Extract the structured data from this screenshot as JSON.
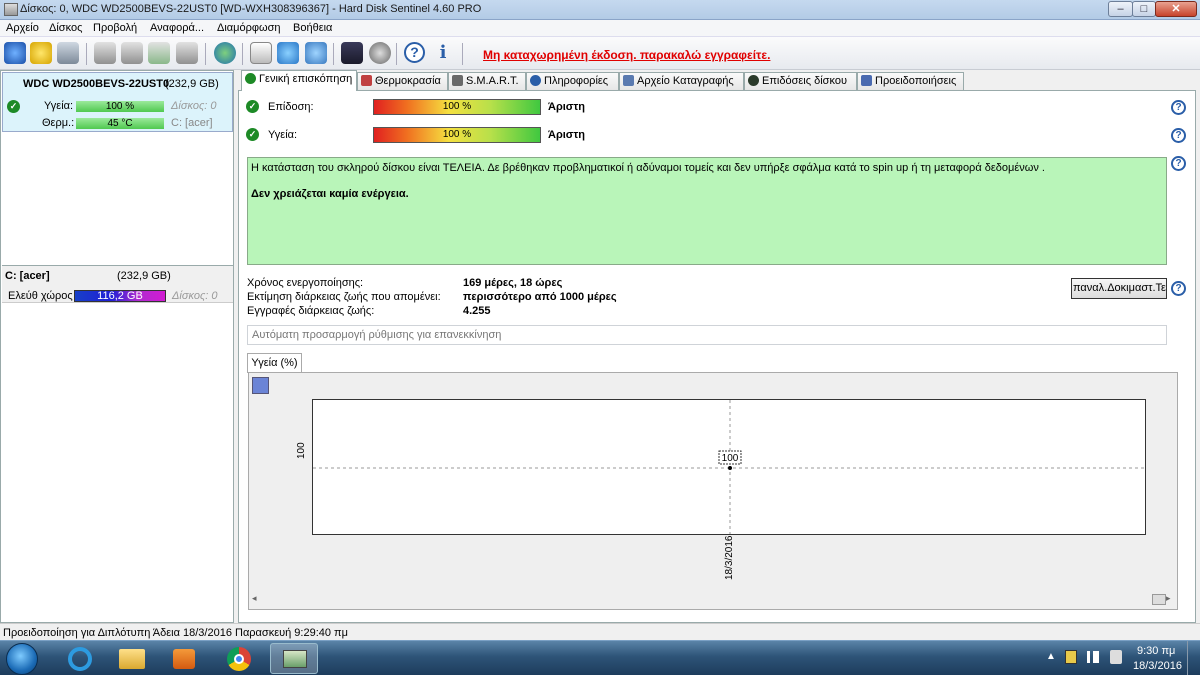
{
  "window": {
    "title": "Δίσκος: 0, WDC WD2500BEVS-22UST0 [WD-WXH308396367]  -  Hard Disk Sentinel 4.60 PRO",
    "minimize": "–",
    "maximize": "□",
    "close": "✕"
  },
  "menu": [
    "Αρχείο",
    "Δίσκος",
    "Προβολή",
    "Αναφορά...",
    "Διαμόρφωση",
    "Βοήθεια"
  ],
  "toolbar": {
    "unregistered": "Μη καταχωρημένη έκδοση. παρακαλώ εγγραφείτε.",
    "icons": [
      "refresh-icon",
      "warning-icon",
      "disk-icon",
      "usb-icon",
      "usb-icon",
      "usb-icon",
      "usb-icon",
      "globe-icon",
      "report-icon",
      "sync-icon",
      "web-icon",
      "test-icon",
      "speaker-icon",
      "help-icon",
      "info-icon"
    ]
  },
  "left": {
    "disk_name": "WDC WD2500BEVS-22UST0",
    "disk_size": "(232,9 GB)",
    "health_label": "Υγεία:",
    "health_value": "100 %",
    "disk_label": "Δίσκος: 0",
    "temp_label": "Θερμ.:",
    "temp_value": "45 °C",
    "drive_label": "C: [acer]",
    "partition_name": "C: [acer]",
    "partition_size": "(232,9 GB)",
    "free_label": "Ελεύθ χώρος",
    "free_value": "116,2 GB",
    "partition_disk": "Δίσκος: 0"
  },
  "tabs": [
    {
      "label": "Γενική επισκόπηση",
      "icon": "check-icon",
      "color": "#1d8a26"
    },
    {
      "label": "Θερμοκρασία",
      "icon": "thermometer-icon",
      "color": "#c04040"
    },
    {
      "label": "S.M.A.R.T.",
      "icon": "smart-icon",
      "color": "#6a6a6a"
    },
    {
      "label": "Πληροφορίες",
      "icon": "info-icon",
      "color": "#2a5ea8"
    },
    {
      "label": "Αρχείο Καταγραφής",
      "icon": "log-icon",
      "color": "#5a7ab0"
    },
    {
      "label": "Επιδόσεις δίσκου",
      "icon": "performance-icon",
      "color": "#2a3a2a"
    },
    {
      "label": "Προειδοποιήσεις",
      "icon": "alerts-icon",
      "color": "#4a6ab0"
    }
  ],
  "overview": {
    "performance_label": "Επίδοση:",
    "performance_value": "100 %",
    "performance_rating": "Άριστη",
    "health_label": "Υγεία:",
    "health_value": "100 %",
    "health_rating": "Άριστη",
    "message": "Η κατάσταση του σκληρού δίσκου είναι ΤΕΛΕΙΑ. Δε βρέθηκαν προβληματικοί ή αδύναμοι τομείς και δεν υπήρξε σφάλμα κατά το spin up ή τη μεταφορά δεδομένων .",
    "action": "Δεν χρειάζεται καμία ενέργεια.",
    "uptime_label": "Χρόνος ενεργοποίησης:",
    "uptime_value": "169 μέρες, 18 ώρες",
    "lifetime_label": "Εκτίμηση διάρκειας ζωής που απομένει:",
    "lifetime_value": "περισσότερο από 1000 μέρες",
    "writes_label": "Εγγραφές διάρκειας ζωής:",
    "writes_value": "4.255",
    "retest_button": "παναλ.Δοκιμαστ.Τεσ",
    "auto_adjust_placeholder": "Αυτόματη προσαρμογή ρύθμισης για επανεκκίνηση",
    "help": "?"
  },
  "chart_tab": "Υγεία (%)",
  "chart_data": {
    "type": "line",
    "x": [
      "18/3/2016"
    ],
    "series": [
      {
        "values": [
          100
        ]
      }
    ],
    "title": "",
    "xlabel": "",
    "ylabel": "",
    "y_tick_labels": [
      "100"
    ],
    "data_labels": [
      "100"
    ],
    "grid": true
  },
  "status": "Προειδοποίηση για Διπλότυπη  Άδεια 18/3/2016 Παρασκευή 9:29:40 πμ",
  "taskbar": {
    "apps": [
      "start-button",
      "ie-icon",
      "explorer-icon",
      "media-player-icon",
      "chrome-icon",
      "hd-sentinel-icon"
    ],
    "time": "9:30 πμ",
    "date": "18/3/2016"
  }
}
